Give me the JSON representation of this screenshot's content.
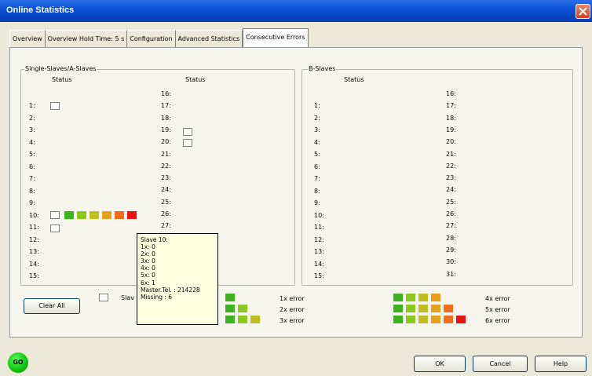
{
  "window": {
    "title": "Online Statistics"
  },
  "tabs": [
    {
      "label": "Overview"
    },
    {
      "label": "Overview  Hold Time: 5 s"
    },
    {
      "label": "Configuration"
    },
    {
      "label": "Advanced Statistics"
    },
    {
      "label": "Consecutive Errors"
    }
  ],
  "left_group": {
    "title": "Single-Slaves/A-Slaves",
    "status_header_1": "Status",
    "status_header_2": "Status",
    "rows_col1": [
      "1:",
      "2:",
      "3:",
      "4:",
      "5:",
      "6:",
      "7:",
      "8:",
      "9:",
      "10:",
      "11:",
      "12:",
      "13:",
      "14:",
      "15:"
    ],
    "rows_col2": [
      "16:",
      "17:",
      "18:",
      "19:",
      "20:",
      "21:",
      "22:",
      "23:",
      "24:",
      "25:",
      "26:",
      "27:"
    ]
  },
  "right_group": {
    "title": "B-Slaves",
    "status_header": "Status",
    "rows_col1": [
      "1:",
      "2:",
      "3:",
      "4:",
      "5:",
      "6:",
      "7:",
      "8:",
      "9:",
      "10:",
      "11:",
      "12:",
      "13:",
      "14:",
      "15:"
    ],
    "rows_col2": [
      "16:",
      "17:",
      "18:",
      "19:",
      "20:",
      "21:",
      "22:",
      "23:",
      "24:",
      "25:",
      "26:",
      "27:",
      "28:",
      "29:",
      "30:",
      "31:"
    ]
  },
  "tooltip": {
    "lines": [
      "Slave 10:",
      "1x:   0",
      "2x:   0",
      "3x:   0",
      "4x:   0",
      "5x:   0",
      "6x:   1",
      "Master.Tel. : 214228",
      "Missing : 6"
    ]
  },
  "legend": {
    "slave_label": "Slav",
    "items": [
      "1x error",
      "2x error",
      "3x error",
      "4x error",
      "5x error",
      "6x error"
    ]
  },
  "error_colors": [
    "#3cb41e",
    "#8cc81e",
    "#bebe1e",
    "#e6a01e",
    "#f06e1e",
    "#ee1111"
  ],
  "buttons": {
    "clear_all": "Clear All",
    "ok": "OK",
    "cancel": "Cancel",
    "help": "Help"
  },
  "status_indicator": {
    "label": "GO"
  }
}
